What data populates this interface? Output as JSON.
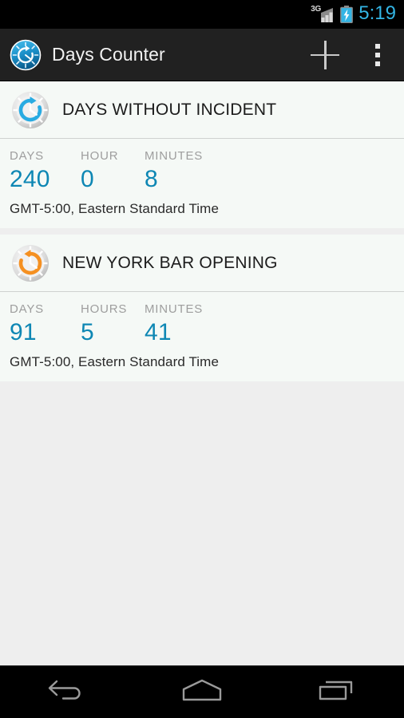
{
  "statusbar": {
    "network_label": "3G",
    "signal_icon": "signal-bars-icon",
    "battery_icon": "battery-charging-icon",
    "time": "5:19",
    "time_color": "#33b5e5"
  },
  "actionbar": {
    "app_icon": "days-counter-app-icon",
    "title": "Days Counter",
    "add_icon": "plus-icon",
    "add_label": "Add counter",
    "overflow_icon": "overflow-menu-icon",
    "overflow_label": "More options",
    "background": "#212121"
  },
  "theme": {
    "accent_blue": "#0e87b4",
    "card_background": "#f5f9f6",
    "list_background": "#eeeeee",
    "label_gray": "#9e9e9e"
  },
  "counters": [
    {
      "icon": "clock-refresh-blue-icon",
      "icon_color": "#29abe2",
      "title": "DAYS WITHOUT INCIDENT",
      "units": [
        {
          "label": "DAYS",
          "value": "240"
        },
        {
          "label": "HOUR",
          "value": "0"
        },
        {
          "label": "MINUTES",
          "value": "8"
        }
      ],
      "timezone": "GMT-5:00, Eastern Standard Time"
    },
    {
      "icon": "clock-rewind-orange-icon",
      "icon_color": "#f59021",
      "title": "NEW YORK BAR OPENING",
      "units": [
        {
          "label": "DAYS",
          "value": "91"
        },
        {
          "label": "HOURS",
          "value": "5"
        },
        {
          "label": "MINUTES",
          "value": "41"
        }
      ],
      "timezone": "GMT-5:00, Eastern Standard Time"
    }
  ],
  "navbar": {
    "back_icon": "back-icon",
    "back_label": "Back",
    "home_icon": "home-icon",
    "home_label": "Home",
    "recents_icon": "recents-icon",
    "recents_label": "Recent apps"
  }
}
